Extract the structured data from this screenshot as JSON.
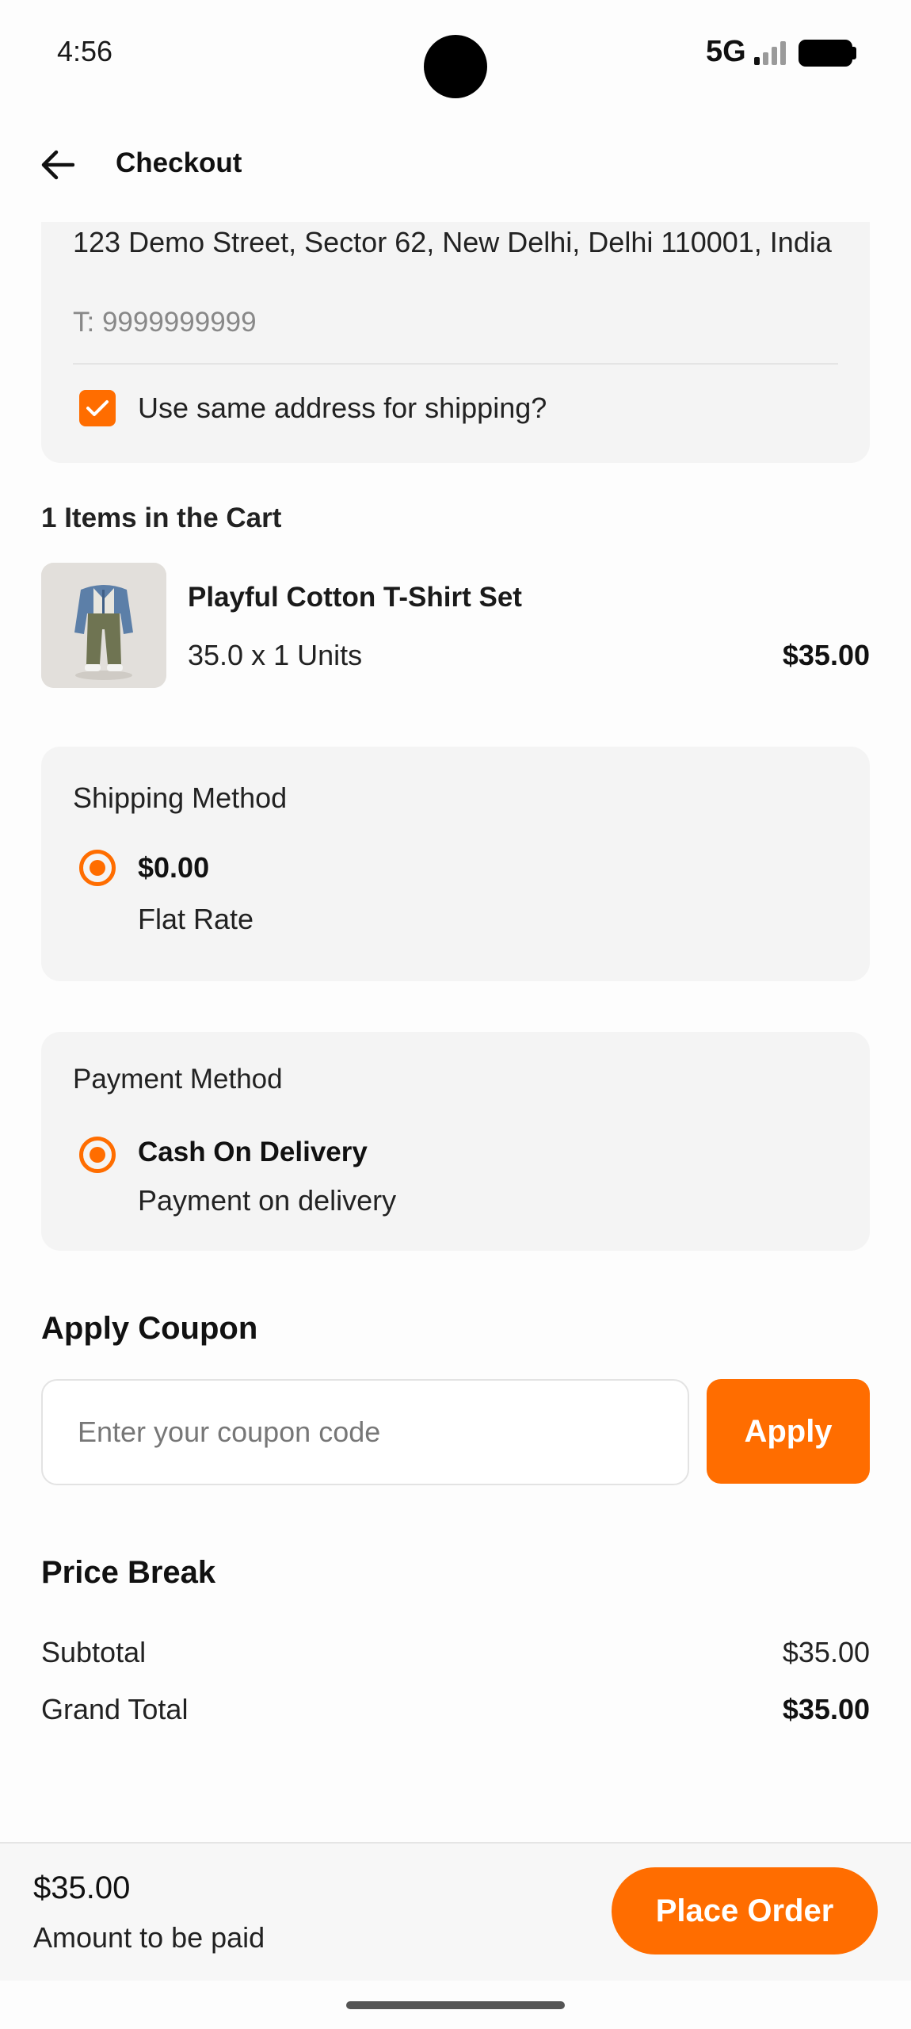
{
  "status_bar": {
    "time": "4:56",
    "network": "5G"
  },
  "header": {
    "title": "Checkout",
    "back_icon": "arrow-left-icon"
  },
  "billing": {
    "address": "123 Demo Street, Sector 62, New Delhi, Delhi 110001, India",
    "phone": "T: 9999999999",
    "same_shipping_label": "Use same address for shipping?",
    "same_shipping_checked": true
  },
  "cart": {
    "count_label": "1 Items in the Cart",
    "items": [
      {
        "name": "Playful Cotton T-Shirt Set",
        "qty_label": "35.0 x 1 Units",
        "price": "$35.00"
      }
    ]
  },
  "shipping": {
    "title": "Shipping Method",
    "selected_price": "$0.00",
    "selected_name": "Flat Rate"
  },
  "payment": {
    "title": "Payment Method",
    "selected_name": "Cash On Delivery",
    "selected_desc": "Payment on delivery"
  },
  "coupon": {
    "heading": "Apply Coupon",
    "placeholder": "Enter your coupon code",
    "value": "",
    "button_label": "Apply"
  },
  "price_break": {
    "heading": "Price Break",
    "rows": [
      {
        "label": "Subtotal",
        "value": "$35.00",
        "bold": false
      },
      {
        "label": "Grand Total",
        "value": "$35.00",
        "bold": true
      }
    ]
  },
  "footer": {
    "amount": "$35.00",
    "caption": "Amount to be paid",
    "button_label": "Place Order"
  },
  "colors": {
    "accent": "#ff6d00",
    "card_bg": "#f4f4f4"
  }
}
